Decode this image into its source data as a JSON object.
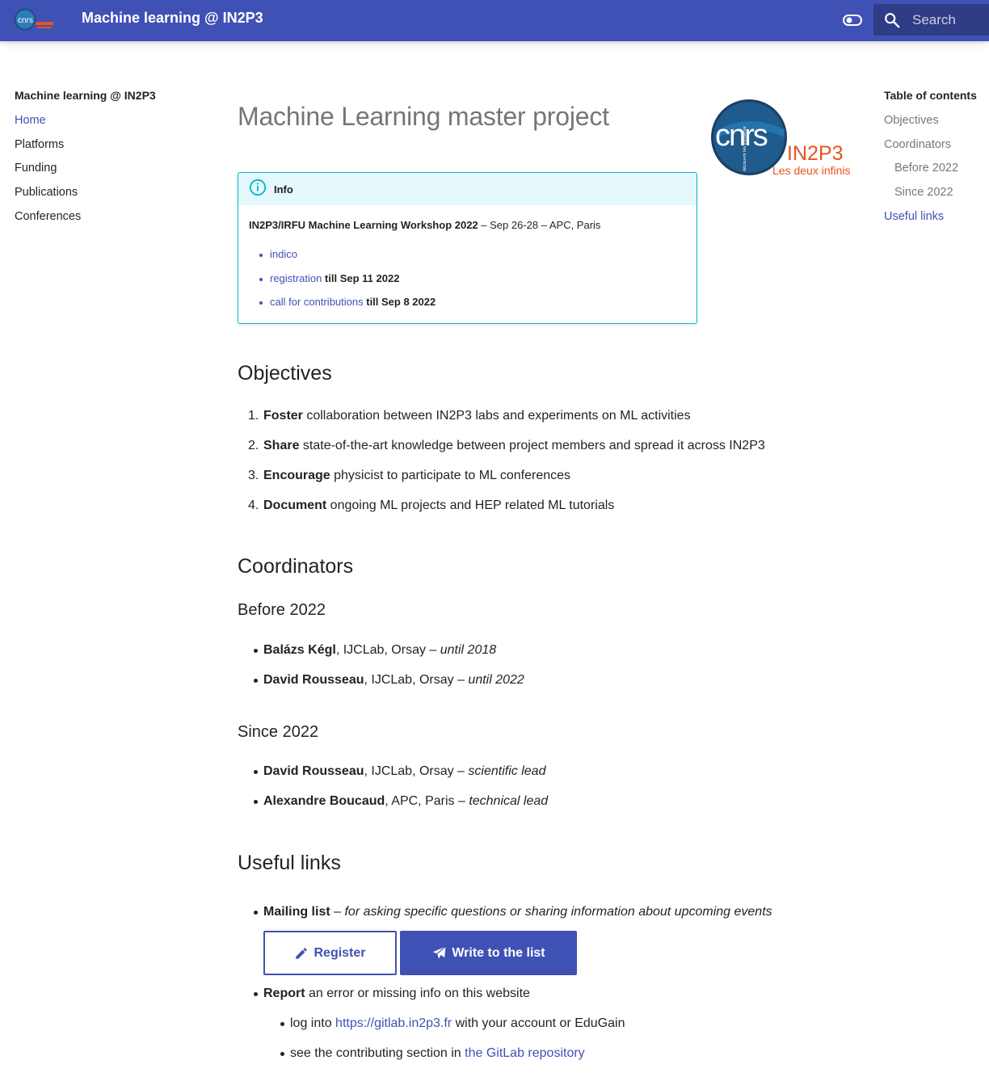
{
  "header": {
    "site_title": "Machine learning @ IN2P3",
    "search_placeholder": "Search",
    "logo_text": "cnrs"
  },
  "nav": {
    "title": "Machine learning @ IN2P3",
    "items": [
      {
        "label": "Home",
        "active": true
      },
      {
        "label": "Platforms"
      },
      {
        "label": "Funding"
      },
      {
        "label": "Publications"
      },
      {
        "label": "Conferences"
      }
    ]
  },
  "toc": {
    "title": "Table of contents",
    "items": [
      {
        "label": "Objectives"
      },
      {
        "label": "Coordinators"
      },
      {
        "label": "Before 2022",
        "sub": true
      },
      {
        "label": "Since 2022",
        "sub": true
      },
      {
        "label": "Useful links",
        "active": true
      }
    ]
  },
  "page": {
    "title": "Machine Learning master project",
    "logo": {
      "main": "cnrs",
      "brand": "IN2P3",
      "tagline": "Les deux infinis",
      "vertical": "découvrir les frontières"
    },
    "info": {
      "label": "Info",
      "workshop_name": "IN2P3/IRFU Machine Learning Workshop 2022",
      "workshop_detail": " – Sep 26-28 – APC, Paris",
      "links": [
        {
          "link": "indico",
          "suffix": ""
        },
        {
          "link": "registration",
          "suffix": " till Sep 11 2022"
        },
        {
          "link": "call for contributions",
          "suffix": " till Sep 8 2022"
        }
      ]
    },
    "objectives": {
      "heading": "Objectives",
      "items": [
        {
          "num": "1.",
          "bold": "Foster",
          "text": " collaboration between IN2P3 labs and experiments on ML activities"
        },
        {
          "num": "2.",
          "bold": "Share",
          "text": " state-of-the-art knowledge between project members and spread it across IN2P3"
        },
        {
          "num": "3.",
          "bold": "Encourage",
          "text": " physicist to participate to ML conferences"
        },
        {
          "num": "4.",
          "bold": "Document",
          "text": " ongoing ML projects and HEP related ML tutorials"
        }
      ]
    },
    "coordinators": {
      "heading": "Coordinators",
      "before": {
        "heading": "Before 2022",
        "items": [
          {
            "name": "Balázs Kégl",
            "affil": ", IJCLab, Orsay – ",
            "role": "until 2018"
          },
          {
            "name": "David Rousseau",
            "affil": ", IJCLab, Orsay – ",
            "role": "until 2022"
          }
        ]
      },
      "since": {
        "heading": "Since 2022",
        "items": [
          {
            "name": "David Rousseau",
            "affil": ", IJCLab, Orsay – ",
            "role": "scientific lead"
          },
          {
            "name": "Alexandre Boucaud",
            "affil": ", APC, Paris – ",
            "role": "technical lead"
          }
        ]
      }
    },
    "links": {
      "heading": "Useful links",
      "mailing_bold": "Mailing list",
      "mailing_dash": " – ",
      "mailing_desc": "for asking specific questions or sharing information about upcoming events",
      "register_label": "Register",
      "write_label": "Write to the list",
      "report_bold": "Report",
      "report_text": " an error or missing info on this website",
      "sub1_pre": "log into ",
      "sub1_link": "https://gitlab.in2p3.fr",
      "sub1_post": " with your account or EduGain",
      "sub2_pre": "see the contributing section in ",
      "sub2_link": "the GitLab repository"
    }
  },
  "colors": {
    "primary": "#4051b5",
    "info": "#00b8d4",
    "in2p3": "#e8541e",
    "cnrs_blue": "#1f4e7a"
  }
}
